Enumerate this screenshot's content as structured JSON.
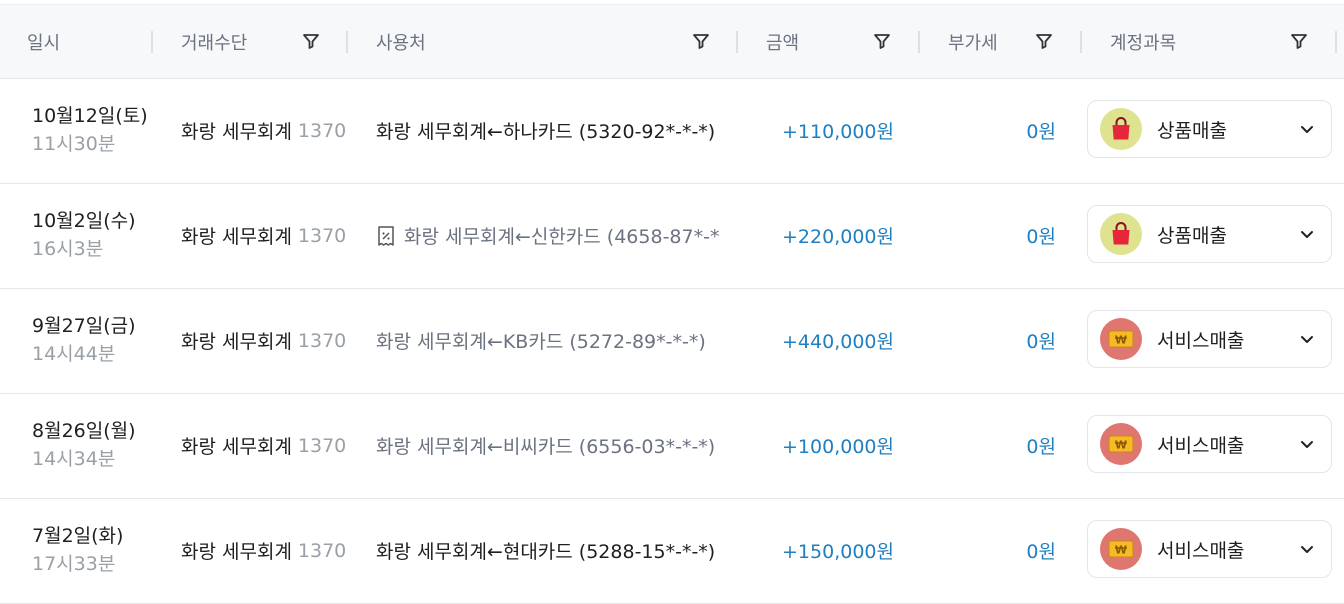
{
  "columns": {
    "date": "일시",
    "method": "거래수단",
    "vendor": "사용처",
    "amount": "금액",
    "vat": "부가세",
    "account": "계정과목"
  },
  "rows": [
    {
      "date": "10월12일(토)",
      "time": "11시30분",
      "method": "화랑 세무회계",
      "method_num": "1370",
      "vendor": "화랑 세무회계←하나카드 (5320-92*-*-*)",
      "amount": "+110,000원",
      "vat": "0원",
      "account": "상품매출",
      "account_icon": "shopping-bag-icon"
    },
    {
      "date": "10월2일(수)",
      "time": "16시3분",
      "method": "화랑 세무회계",
      "method_num": "1370",
      "vendor": "화랑 세무회계←신한카드 (4658-87*-*",
      "amount": "+220,000원",
      "vat": "0원",
      "account": "상품매출",
      "account_icon": "shopping-bag-icon"
    },
    {
      "date": "9월27일(금)",
      "time": "14시44분",
      "method": "화랑 세무회계",
      "method_num": "1370",
      "vendor": "화랑 세무회계←KB카드 (5272-89*-*-*)",
      "amount": "+440,000원",
      "vat": "0원",
      "account": "서비스매출",
      "account_icon": "won-coin-icon"
    },
    {
      "date": "8월26일(월)",
      "time": "14시34분",
      "method": "화랑 세무회계",
      "method_num": "1370",
      "vendor": "화랑 세무회계←비씨카드 (6556-03*-*-*)",
      "amount": "+100,000원",
      "vat": "0원",
      "account": "서비스매출",
      "account_icon": "won-coin-icon"
    },
    {
      "date": "7월2일(화)",
      "time": "17시33분",
      "method": "화랑 세무회계",
      "method_num": "1370",
      "vendor": "화랑 세무회계←현대카드 (5288-15*-*-*)",
      "amount": "+150,000원",
      "vat": "0원",
      "account": "서비스매출",
      "account_icon": "won-coin-icon"
    }
  ],
  "colors": {
    "amount": "#1f7fc0",
    "header_bg": "#f7f8fa",
    "goods_badge": "#dfe38f",
    "service_badge": "#df7670"
  }
}
